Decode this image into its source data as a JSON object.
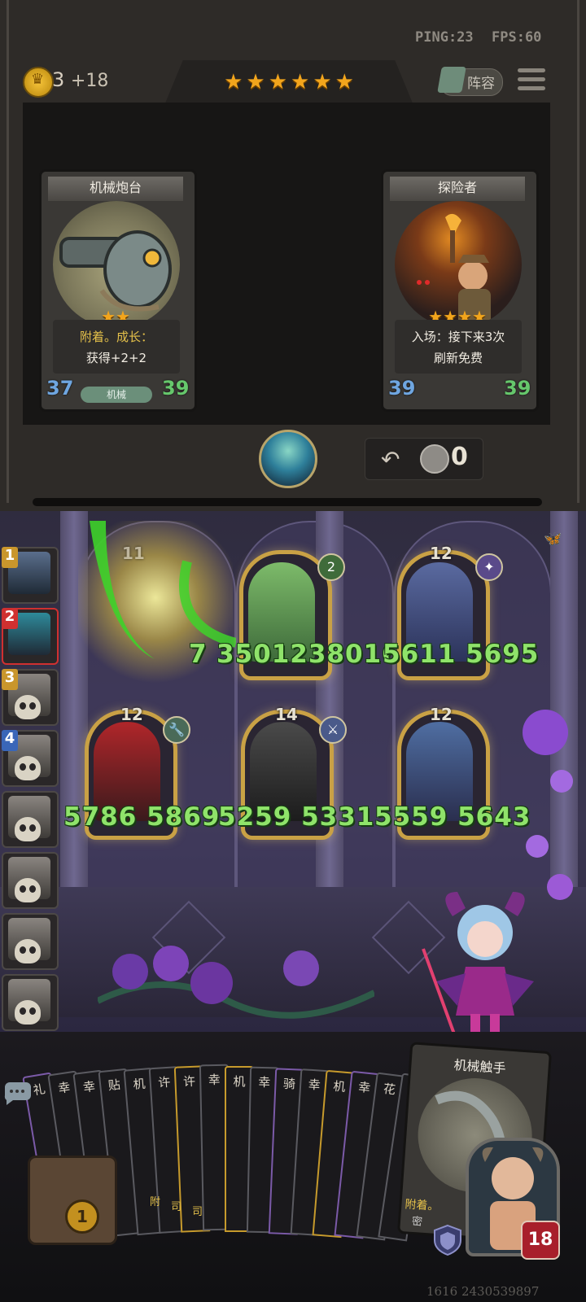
{
  "hud": {
    "ping": "PING:23",
    "fps": "FPS:60"
  },
  "gold": {
    "amount": "3",
    "income": "+18"
  },
  "tavern": {
    "stars": [
      "★",
      "★",
      "★",
      "★",
      "★",
      "★"
    ]
  },
  "lineup_label": "阵容",
  "shop_cards": [
    {
      "name": "机械炮台",
      "stars": [
        "★",
        "★"
      ],
      "desc_line1": "附着。成长：",
      "desc_line2": "获得+2+2",
      "attack": "37",
      "health": "39",
      "tribe": "机械",
      "icon": "cannon-turret-art"
    },
    {
      "name": "探险者",
      "stars": [
        "★",
        "★",
        "★",
        "★"
      ],
      "desc_line1": "入场：接下来3次",
      "desc_line2": "刷新免费",
      "attack": "39",
      "health": "39",
      "tribe": "",
      "icon": "explorer-torch-art"
    }
  ],
  "refresh": {
    "cost": "0",
    "icon": "refresh-icon"
  },
  "rankings": [
    {
      "rank": "1",
      "eliminated": false,
      "color": "#c9962c"
    },
    {
      "rank": "2",
      "eliminated": false,
      "color": "#d03030",
      "current": true
    },
    {
      "rank": "3",
      "eliminated": true,
      "color": "#c9962c"
    },
    {
      "rank": "4",
      "eliminated": true,
      "color": "#3a66b8"
    },
    {
      "rank": "",
      "eliminated": true
    },
    {
      "rank": "",
      "eliminated": true
    },
    {
      "rank": "",
      "eliminated": true
    },
    {
      "rank": "",
      "eliminated": true
    }
  ],
  "board_minions": [
    {
      "level": "11",
      "badge": "",
      "damage": "",
      "note": "being hit by green slash effect"
    },
    {
      "level": "",
      "badge": "2",
      "badge_color": "#3f6b3a",
      "damage": "3501238016"
    },
    {
      "level": "12",
      "badge": "✦",
      "badge_color": "#5a4a8a",
      "damage": "5611 5695"
    },
    {
      "level": "12",
      "badge": "🔧",
      "badge_color": "#4a6a58",
      "damage": "5786 5869"
    },
    {
      "level": "14",
      "badge": "⚔",
      "badge_color": "#4a5a8a",
      "damage": "5259 5331"
    },
    {
      "level": "12",
      "badge": "",
      "damage": "5559 5643"
    }
  ],
  "partial_damage": "7",
  "hand_cards": [
    "礼",
    "幸",
    "幸",
    "贴",
    "机",
    "许",
    "许",
    "幸",
    "机",
    "幸",
    "骑",
    "幸",
    "机",
    "幸",
    "花",
    "贴"
  ],
  "hand_card_colors": [
    "purple",
    "",
    "",
    "",
    "",
    "",
    "gold",
    "",
    "gold",
    "",
    "purple",
    "",
    "gold",
    "purple",
    "",
    ""
  ],
  "hand_bottom_labels": [
    "附",
    "司",
    "司"
  ],
  "big_hand_card": {
    "name": "机械触手",
    "desc": "附着。",
    "desc2": "密"
  },
  "chest_count": "1",
  "player": {
    "health": "18"
  },
  "footer_id": "1616 2430539897"
}
